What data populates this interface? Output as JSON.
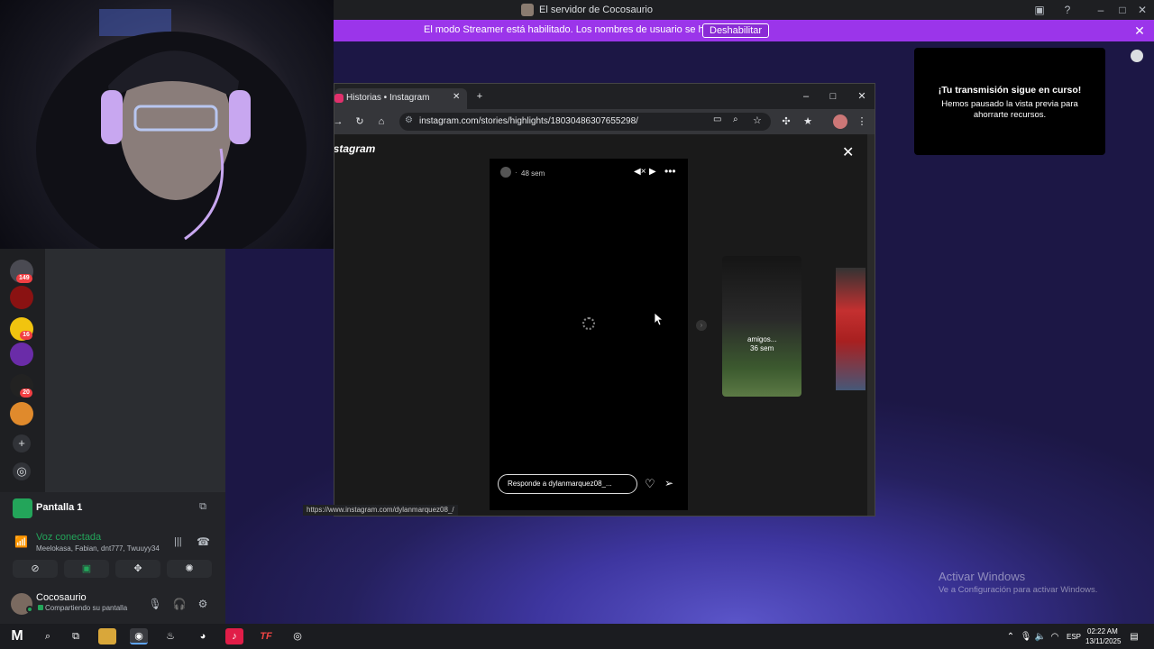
{
  "window": {
    "title": "El servidor de Cocosaurio"
  },
  "streamer_banner": {
    "text": "El modo Streamer está habilitado. Los nombres de usuario se han truncado.",
    "button": "Deshabilitar"
  },
  "stream_notice": {
    "title": "¡Tu transmisión sigue en curso!",
    "body": "Hemos pausado la vista previa para ahorrarte recursos."
  },
  "server_rail": {
    "badges": [
      "149",
      "16",
      "20"
    ]
  },
  "browser": {
    "tab_title": "Historias • Instagram",
    "url": "instagram.com/stories/highlights/18030486307655298/",
    "logo_text": "Instagram",
    "status_url": "https://www.instagram.com/dylanmarquez08_/",
    "story": {
      "time": "48 sem",
      "reply_placeholder": "Responde a dylanmarquez08_...",
      "next_label": "amigos...",
      "next_time": "36 sem"
    }
  },
  "voice_panel": {
    "screen_title": "Pantalla 1",
    "status": "Voz conectada",
    "participants": "Meelokasa, Fabian, dnt777, Twuuyy34"
  },
  "user": {
    "name": "Cocosaurio",
    "status": "Compartiendo su pantalla"
  },
  "watermark": {
    "title": "Activar Windows",
    "subtitle": "Ve a Configuración para activar Windows."
  },
  "taskbar": {
    "lang": "ESP",
    "time": "02:22 AM",
    "date": "13/11/2025"
  },
  "colors": {
    "streamer_purple": "#9b35ea",
    "discord_green": "#23a55a",
    "badge_red": "#f23f43"
  }
}
